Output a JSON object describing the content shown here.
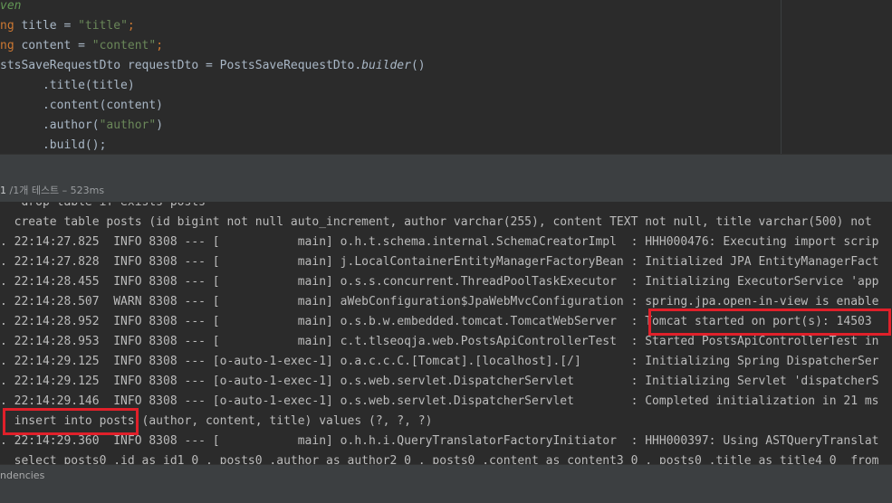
{
  "editor": {
    "lines": [
      {
        "frag1": "ven",
        "frag2": "",
        "frag3": "",
        "frag4": ""
      },
      {
        "frag1": "ng",
        "frag2": " title = ",
        "frag3": "\"title\"",
        "frag4": ";"
      },
      {
        "frag1": "ng",
        "frag2": " content = ",
        "frag3": "\"content\"",
        "frag4": ";"
      },
      {
        "frag1": "stsSaveRequestDto requestDto = PostsSaveRequestDto.",
        "frag2": "builder",
        "frag3": "()",
        "frag4": ""
      },
      {
        "frag1": "      .title(title)",
        "frag2": "",
        "frag3": "",
        "frag4": ""
      },
      {
        "frag1": "      .content(content)",
        "frag2": "",
        "frag3": "",
        "frag4": ""
      },
      {
        "frag1": "      .author(",
        "frag2": "\"author\"",
        "frag3": ")",
        "frag4": ""
      },
      {
        "frag1": "      .build();",
        "frag2": "",
        "frag3": "",
        "frag4": ""
      }
    ]
  },
  "run_status": {
    "count": "1",
    "summary": " /1개 테스트 – 523ms"
  },
  "console": {
    "lines": [
      "   drop table if exists posts",
      "  create table posts (id bigint not null auto_increment, author varchar(255), content TEXT not null, title varchar(500) not",
      ". 22:14:27.825  INFO 8308 --- [           main] o.h.t.schema.internal.SchemaCreatorImpl  : HHH000476: Executing import scrip",
      ". 22:14:27.828  INFO 8308 --- [           main] j.LocalContainerEntityManagerFactoryBean : Initialized JPA EntityManagerFact",
      ". 22:14:28.455  INFO 8308 --- [           main] o.s.s.concurrent.ThreadPoolTaskExecutor  : Initializing ExecutorService 'app",
      ". 22:14:28.507  WARN 8308 --- [           main] aWebConfiguration$JpaWebMvcConfiguration : spring.jpa.open-in-view is enable",
      ". 22:14:28.952  INFO 8308 --- [           main] o.s.b.w.embedded.tomcat.TomcatWebServer  : Tomcat started on port(s): 14503",
      ". 22:14:28.953  INFO 8308 --- [           main] c.t.tlseoqja.web.PostsApiControllerTest  : Started PostsApiControllerTest in",
      ". 22:14:29.125  INFO 8308 --- [o-auto-1-exec-1] o.a.c.c.C.[Tomcat].[localhost].[/]       : Initializing Spring DispatcherSer",
      ". 22:14:29.125  INFO 8308 --- [o-auto-1-exec-1] o.s.web.servlet.DispatcherServlet        : Initializing Servlet 'dispatcherS",
      ". 22:14:29.146  INFO 8308 --- [o-auto-1-exec-1] o.s.web.servlet.DispatcherServlet        : Completed initialization in 21 ms",
      "  insert into posts (author, content, title) values (?, ?, ?)",
      ". 22:14:29.360  INFO 8308 --- [           main] o.h.h.i.QueryTranslatorFactoryInitiator  : HHH000397: Using ASTQueryTranslat",
      "  select posts0_.id as id1_0_, posts0_.author as author2_0_, posts0_.content as content3_0_, posts0_.title as title4_0_ from"
    ]
  },
  "bottom": {
    "tab_label": "ndencies"
  },
  "colors": {
    "highlight": "#e0202a",
    "keyword": "#cc7832",
    "string": "#6a8759"
  }
}
